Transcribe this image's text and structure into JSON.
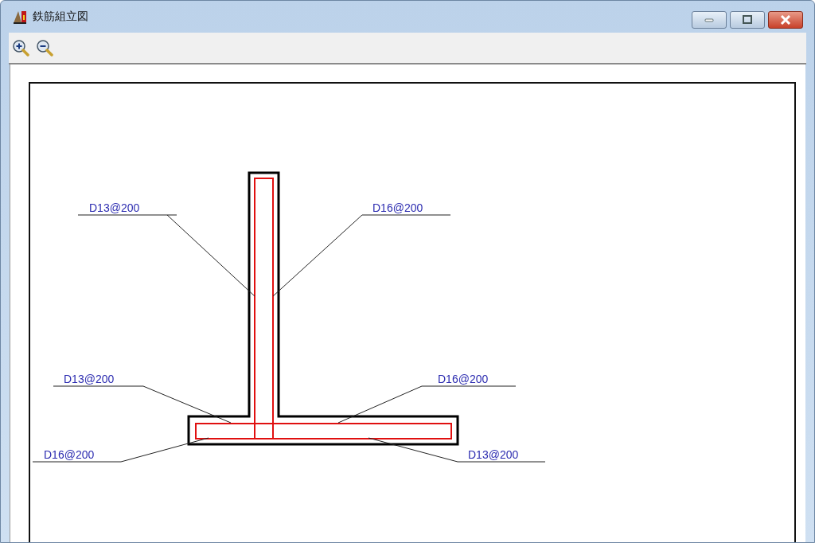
{
  "window": {
    "title": "鉄筋組立図"
  },
  "drawing": {
    "labels": [
      "D13@200",
      "D16@200",
      "D13@200",
      "D16@200",
      "D16@200",
      "D13@200"
    ]
  }
}
